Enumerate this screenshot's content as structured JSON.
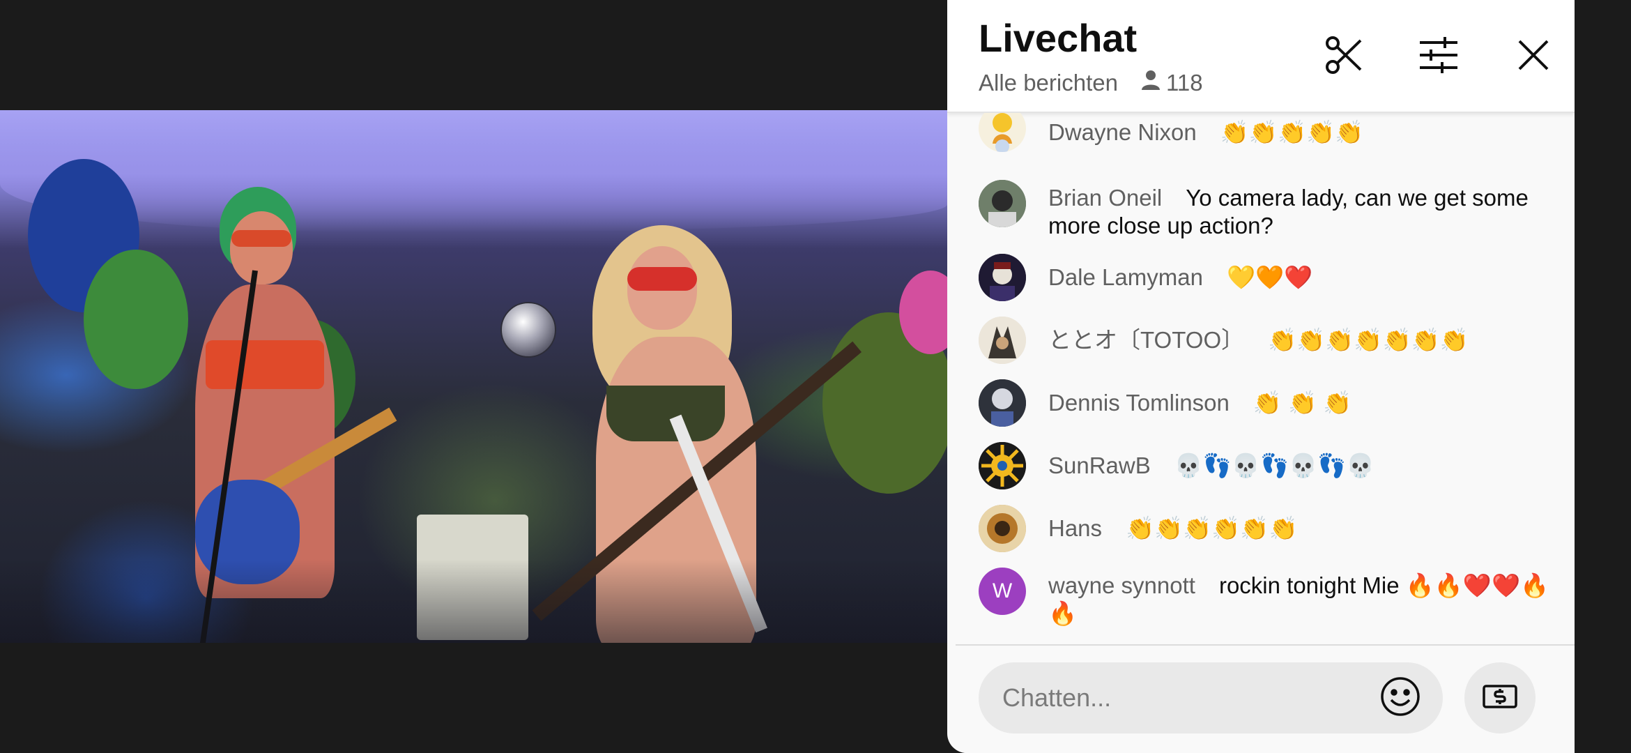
{
  "chat": {
    "title": "Livechat",
    "filter_label": "Alle berichten",
    "viewer_count": "118",
    "input_placeholder": "Chatten...",
    "messages": [
      {
        "author": "Dwayne Nixon",
        "text": "👏👏👏👏👏",
        "avatar_color": "#f5d64b",
        "avatar_initial": ""
      },
      {
        "author": "Brian Oneil",
        "text": "Yo camera lady, can we get some more close up action?",
        "avatar_color": "#4f5a4e",
        "avatar_initial": ""
      },
      {
        "author": "Dale Lamyman",
        "text": "💛🧡❤️",
        "avatar_color": "#2a2340",
        "avatar_initial": ""
      },
      {
        "author": "ととオ〔TOTOO〕",
        "text": "👏👏👏👏👏👏👏",
        "avatar_color": "#c9bca8",
        "avatar_initial": ""
      },
      {
        "author": "Dennis Tomlinson",
        "text": "👏 👏 👏",
        "avatar_color": "#33363f",
        "avatar_initial": ""
      },
      {
        "author": "SunRawB",
        "text": "💀👣💀👣💀👣💀",
        "avatar_color": "#f2b81e",
        "avatar_initial": ""
      },
      {
        "author": "Hans",
        "text": "👏👏👏👏👏👏",
        "avatar_color": "#c79a52",
        "avatar_initial": ""
      },
      {
        "author": "wayne synnott",
        "text": "rockin tonight Mie 🔥🔥❤️❤️🔥🔥",
        "avatar_color": "#9c3fc0",
        "avatar_initial": "W"
      }
    ]
  },
  "icons": {
    "clip": "scissors-icon",
    "settings": "sliders-icon",
    "close": "close-icon",
    "viewers": "person-icon",
    "emoji": "smiley-icon",
    "superchat": "dollar-note-icon"
  }
}
